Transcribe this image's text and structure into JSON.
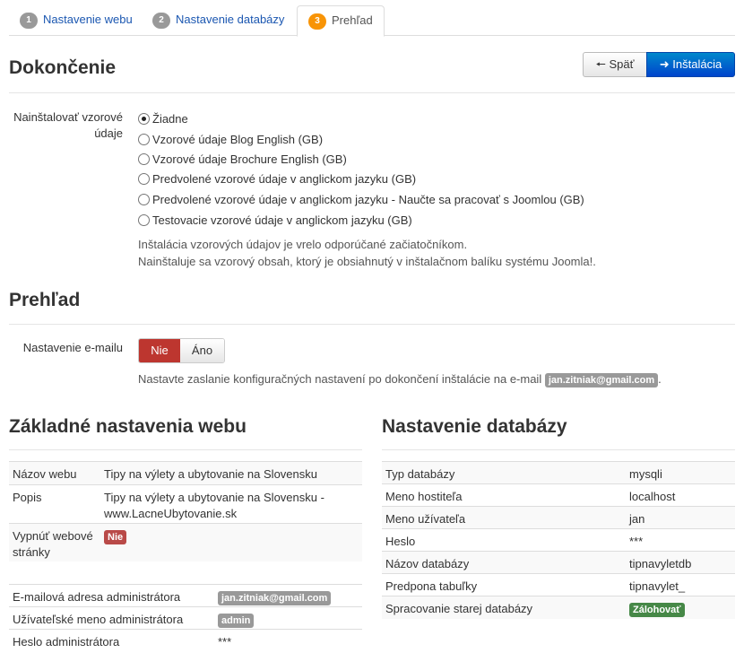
{
  "tabs": [
    {
      "num": "1",
      "label": "Nastavenie webu"
    },
    {
      "num": "2",
      "label": "Nastavenie databázy"
    },
    {
      "num": "3",
      "label": "Prehľad"
    }
  ],
  "finish": {
    "title": "Dokončenie",
    "back_label": "Späť",
    "install_label": "Inštalácia",
    "sample_label_1": "Nainštalovať vzorové",
    "sample_label_2": "údaje",
    "options": [
      "Žiadne",
      "Vzorové údaje Blog English (GB)",
      "Vzorové údaje Brochure English (GB)",
      "Predvolené vzorové údaje v anglickom jazyku (GB)",
      "Predvolené vzorové údaje v anglickom jazyku - Naučte sa pracovať s Joomlou (GB)",
      "Testovacie vzorové údaje v anglickom jazyku (GB)"
    ],
    "selected": "Žiadne",
    "help_1": "Inštalácia vzorových údajov je vrelo odporúčané začiatočníkom.",
    "help_2": "Nainštaluje sa vzorový obsah, ktorý je obsiahnutý v inštalačnom balíku systému Joomla!."
  },
  "overview": {
    "title": "Prehľad",
    "email_label": "Nastavenie e-mailu",
    "toggle_no": "Nie",
    "toggle_yes": "Áno",
    "email_help": "Nastavte zaslanie konfiguračných nastavení po dokončení inštalácie na e-mail",
    "email_value": "jan.zitniak@gmail.com",
    "email_help_end": "."
  },
  "site": {
    "title": "Základné nastavenia webu",
    "name_label": "Názov webu",
    "name_value": "Tipy na výlety a ubytovanie na Slovensku",
    "desc_label": "Popis",
    "desc_value_1": "Tipy na výlety a ubytovanie na Slovensku -",
    "desc_value_2": "www.LacneUbytovanie.sk",
    "offline_label_1": "Vypnúť webové",
    "offline_label_2": "stránky",
    "offline_value": "Nie",
    "admin_email_label": "E-mailová adresa administrátora",
    "admin_email_value": "jan.zitniak@gmail.com",
    "admin_user_label": "Užívateľské meno administrátora",
    "admin_user_value": "admin",
    "admin_pass_label": "Heslo administrátora",
    "admin_pass_value": "***"
  },
  "db": {
    "title": "Nastavenie databázy",
    "rows": [
      {
        "k": "Typ databázy",
        "v": "mysqli"
      },
      {
        "k": "Meno hostiteľa",
        "v": "localhost"
      },
      {
        "k": "Meno užívateľa",
        "v": "jan"
      },
      {
        "k": "Heslo",
        "v": "***"
      },
      {
        "k": "Názov databázy",
        "v": "tipnavyletdb"
      },
      {
        "k": "Predpona tabuľky",
        "v": "tipnavylet_"
      }
    ],
    "old_label": "Spracovanie starej databázy",
    "old_value": "Zálohovať"
  },
  "colors": {
    "accent": "#0044cc",
    "danger": "#bd362f",
    "success": "#468847",
    "step_active": "#f89406"
  }
}
